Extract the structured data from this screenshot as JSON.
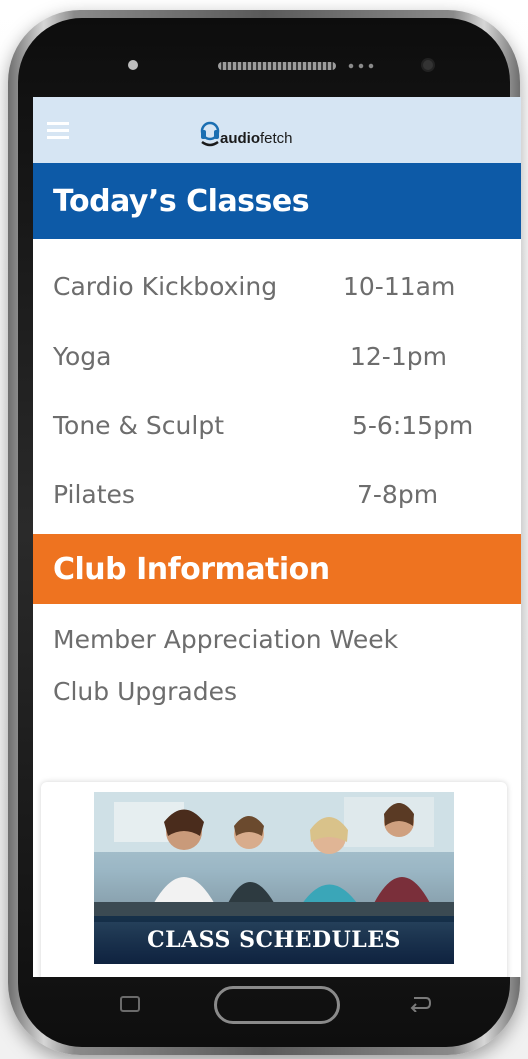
{
  "app": {
    "logo_text_bold": "audio",
    "logo_text_regular": "fetch"
  },
  "todays_classes": {
    "title": "Today’s Classes",
    "classes": [
      {
        "name": "Cardio Kickboxing",
        "time": "10-11am"
      },
      {
        "name": "Yoga",
        "time": "12-1pm"
      },
      {
        "name": "Tone & Sculpt",
        "time": "5-6:15pm"
      },
      {
        "name": "Pilates",
        "time": "7-8pm"
      }
    ]
  },
  "club_information": {
    "title": "Club Information",
    "items": [
      "Member Appreciation Week",
      "Club Upgrades"
    ]
  },
  "banner": {
    "caption": "CLASS SCHEDULES"
  },
  "colors": {
    "header_bg": "#d6e5f3",
    "classes_bar": "#0d5aa7",
    "info_bar": "#ee7320",
    "body_text": "#6d6d6d"
  },
  "icons": [
    "hamburger-menu-icon",
    "audiofetch-logo",
    "recent-apps-icon",
    "home-button",
    "back-icon"
  ]
}
